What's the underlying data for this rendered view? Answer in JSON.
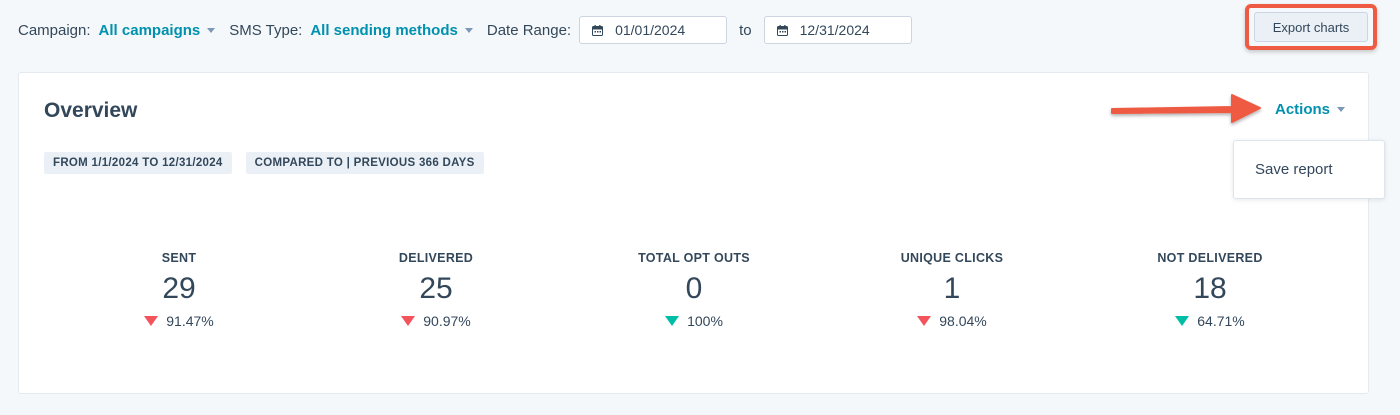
{
  "filters": {
    "campaign_label": "Campaign:",
    "campaign_value": "All campaigns",
    "sms_type_label": "SMS Type:",
    "sms_type_value": "All sending methods",
    "date_range_label": "Date Range:",
    "start_date": "01/01/2024",
    "to_label": "to",
    "end_date": "12/31/2024"
  },
  "export_button": "Export charts",
  "overview": {
    "title": "Overview",
    "tags": [
      "FROM 1/1/2024 TO 12/31/2024",
      "COMPARED TO | PREVIOUS 366 DAYS"
    ],
    "actions_label": "Actions",
    "dropdown_item": "Save report"
  },
  "metrics": [
    {
      "label": "SENT",
      "value": "29",
      "change": "91.47%",
      "direction": "down",
      "color": "#f2545b"
    },
    {
      "label": "DELIVERED",
      "value": "25",
      "change": "90.97%",
      "direction": "down",
      "color": "#f2545b"
    },
    {
      "label": "TOTAL OPT OUTS",
      "value": "0",
      "change": "100%",
      "direction": "down",
      "color": "#00bda5"
    },
    {
      "label": "UNIQUE CLICKS",
      "value": "1",
      "change": "98.04%",
      "direction": "down",
      "color": "#f2545b"
    },
    {
      "label": "NOT DELIVERED",
      "value": "18",
      "change": "64.71%",
      "direction": "down",
      "color": "#00bda5"
    }
  ],
  "colors": {
    "accent": "#0091ae",
    "highlight": "#ee5a42",
    "negative": "#f2545b",
    "positive": "#00bda5"
  }
}
